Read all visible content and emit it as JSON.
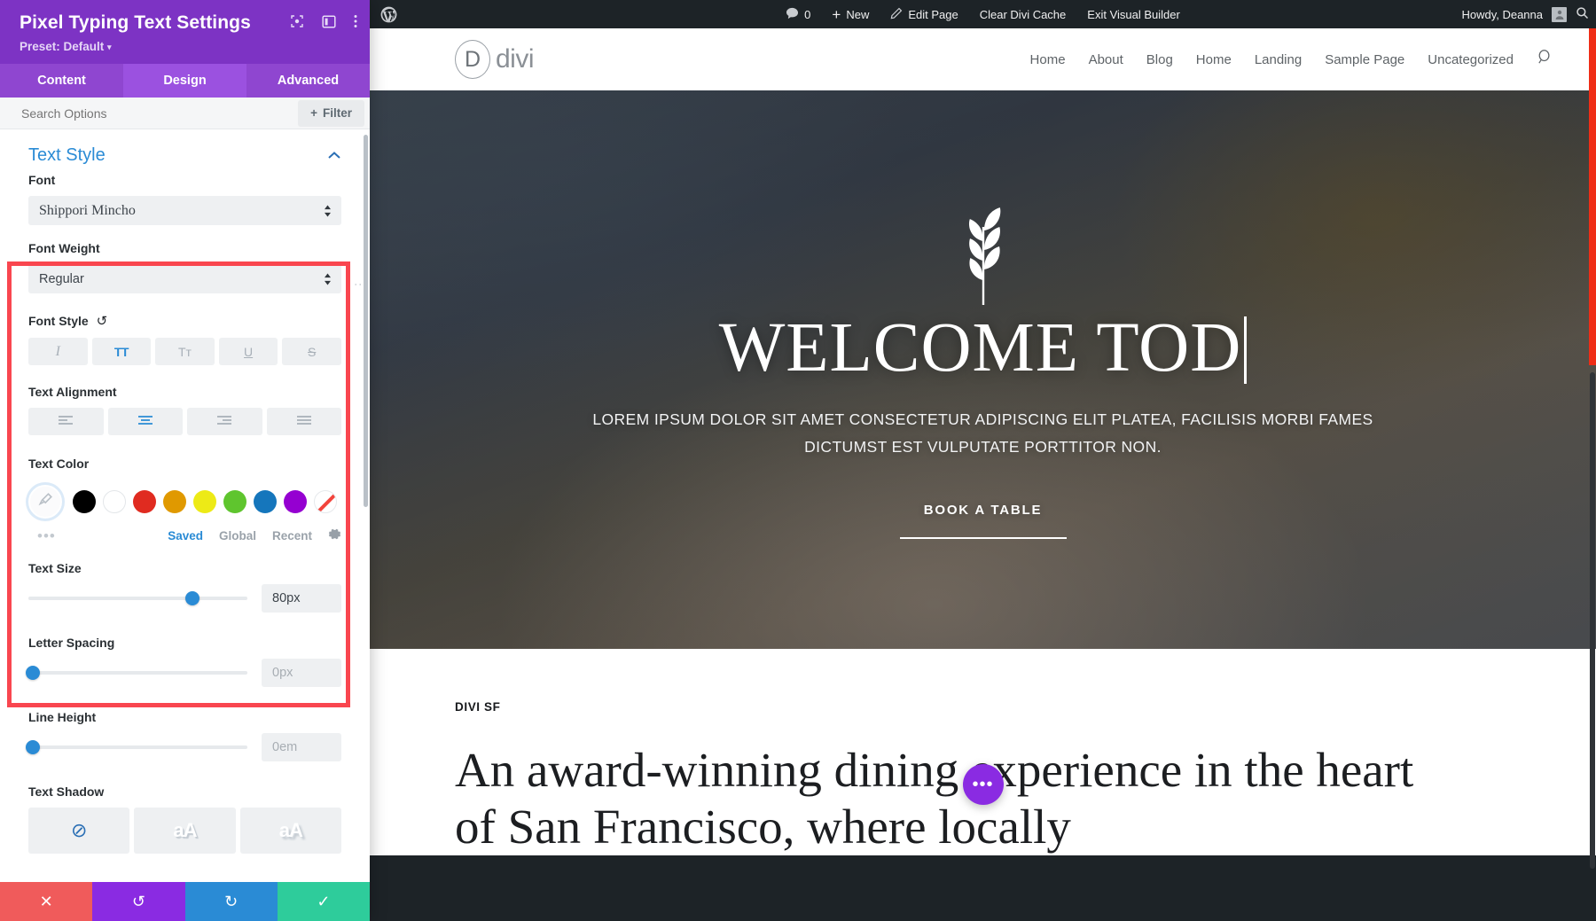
{
  "panel": {
    "title": "Pixel Typing Text Settings",
    "preset": "Preset: Default",
    "preset_caret": "▾",
    "icons": {
      "target": "target-icon",
      "layout": "layout-icon",
      "more": "more-vertical-icon"
    },
    "tabs": [
      {
        "label": "Content",
        "active": false
      },
      {
        "label": "Design",
        "active": true
      },
      {
        "label": "Advanced",
        "active": false
      }
    ],
    "search_placeholder": "Search Options",
    "filter_label": "Filter",
    "filter_icon": "plus-icon",
    "section": {
      "title": "Text Style",
      "collapse_icon": "chevron-up-icon"
    },
    "fields": {
      "font": {
        "label": "Font",
        "value": "Shippori Mincho"
      },
      "font_weight": {
        "label": "Font Weight",
        "value": "Regular"
      },
      "font_style": {
        "label": "Font Style",
        "reset_icon": "reset-icon",
        "buttons": [
          {
            "name": "italic",
            "glyph": "I",
            "active": false
          },
          {
            "name": "uppercase",
            "glyph": "TT",
            "active": true
          },
          {
            "name": "small-caps",
            "glyph": "Tᴛ",
            "active": false
          },
          {
            "name": "underline",
            "glyph": "U",
            "active": false
          },
          {
            "name": "strikethrough",
            "glyph": "S",
            "active": false
          }
        ]
      },
      "text_alignment": {
        "label": "Text Alignment",
        "buttons": [
          {
            "name": "align-left",
            "active": false
          },
          {
            "name": "align-center",
            "active": true
          },
          {
            "name": "align-right",
            "active": false
          },
          {
            "name": "align-justify",
            "active": false
          }
        ]
      },
      "text_color": {
        "label": "Text Color",
        "picker_icon": "eyedropper-icon",
        "swatches": [
          {
            "name": "black",
            "hex": "#000000"
          },
          {
            "name": "white",
            "hex": "#ffffff"
          },
          {
            "name": "red",
            "hex": "#e02b20"
          },
          {
            "name": "orange",
            "hex": "#e09900"
          },
          {
            "name": "yellow",
            "hex": "#edea16"
          },
          {
            "name": "green",
            "hex": "#5fc52e"
          },
          {
            "name": "blue",
            "hex": "#1576bc"
          },
          {
            "name": "purple",
            "hex": "#9500d1"
          },
          {
            "name": "none",
            "hex": "#ffffff"
          }
        ],
        "more_dots": "•••",
        "tabs": [
          {
            "label": "Saved",
            "active": true
          },
          {
            "label": "Global",
            "active": false
          },
          {
            "label": "Recent",
            "active": false
          }
        ],
        "gear_icon": "gear-icon"
      },
      "text_size": {
        "label": "Text Size",
        "value": "80px",
        "percent": 75,
        "placeholder": false
      },
      "letter_spacing": {
        "label": "Letter Spacing",
        "value": "0px",
        "percent": 2,
        "placeholder": true
      },
      "line_height": {
        "label": "Line Height",
        "value": "0em",
        "percent": 2,
        "placeholder": true
      },
      "text_shadow": {
        "label": "Text Shadow",
        "buttons": [
          {
            "name": "none",
            "glyph": "⊘"
          },
          {
            "name": "light",
            "glyph": "aA"
          },
          {
            "name": "strong",
            "glyph": "aA"
          }
        ]
      }
    },
    "actions": [
      {
        "name": "close-button",
        "glyph": "✕",
        "color": "#f05b5b"
      },
      {
        "name": "undo-button",
        "glyph": "↺",
        "color": "#8a2be2"
      },
      {
        "name": "redo-button",
        "glyph": "↻",
        "color": "#2a8bd5"
      },
      {
        "name": "save-button",
        "glyph": "✓",
        "color": "#2ecc9b"
      }
    ]
  },
  "adminbar": {
    "logo": "wordpress-icon",
    "comments_icon": "comment-icon",
    "comments_count": "0",
    "new_icon": "plus-icon",
    "new_label": "New",
    "edit_icon": "pencil-icon",
    "edit_label": "Edit Page",
    "clear_cache_label": "Clear Divi Cache",
    "exit_builder_label": "Exit Visual Builder",
    "howdy_label": "Howdy, Deanna",
    "avatar": "user-avatar",
    "search_icon": "search-icon"
  },
  "site": {
    "logo_letter": "D",
    "logo_word": "divi",
    "nav": [
      "Home",
      "About",
      "Blog",
      "Home",
      "Landing",
      "Sample Page",
      "Uncategorized"
    ],
    "nav_search_icon": "search-icon",
    "hero": {
      "sprig_icon": "leaf-sprig-icon",
      "title": "WELCOME TOD",
      "subtitle": "LOREM IPSUM DOLOR SIT AMET CONSECTETUR ADIPISCING ELIT PLATEA, FACILISIS MORBI FAMES DICTUMST EST VULPUTATE PORTTITOR NON.",
      "cta": "BOOK A TABLE"
    },
    "content": {
      "eyebrow": "DIVI SF",
      "heading": "An award-winning dining experience in the heart of San Francisco, where locally"
    },
    "fab_icon": "ellipsis-icon",
    "fab_glyph": "•••"
  }
}
